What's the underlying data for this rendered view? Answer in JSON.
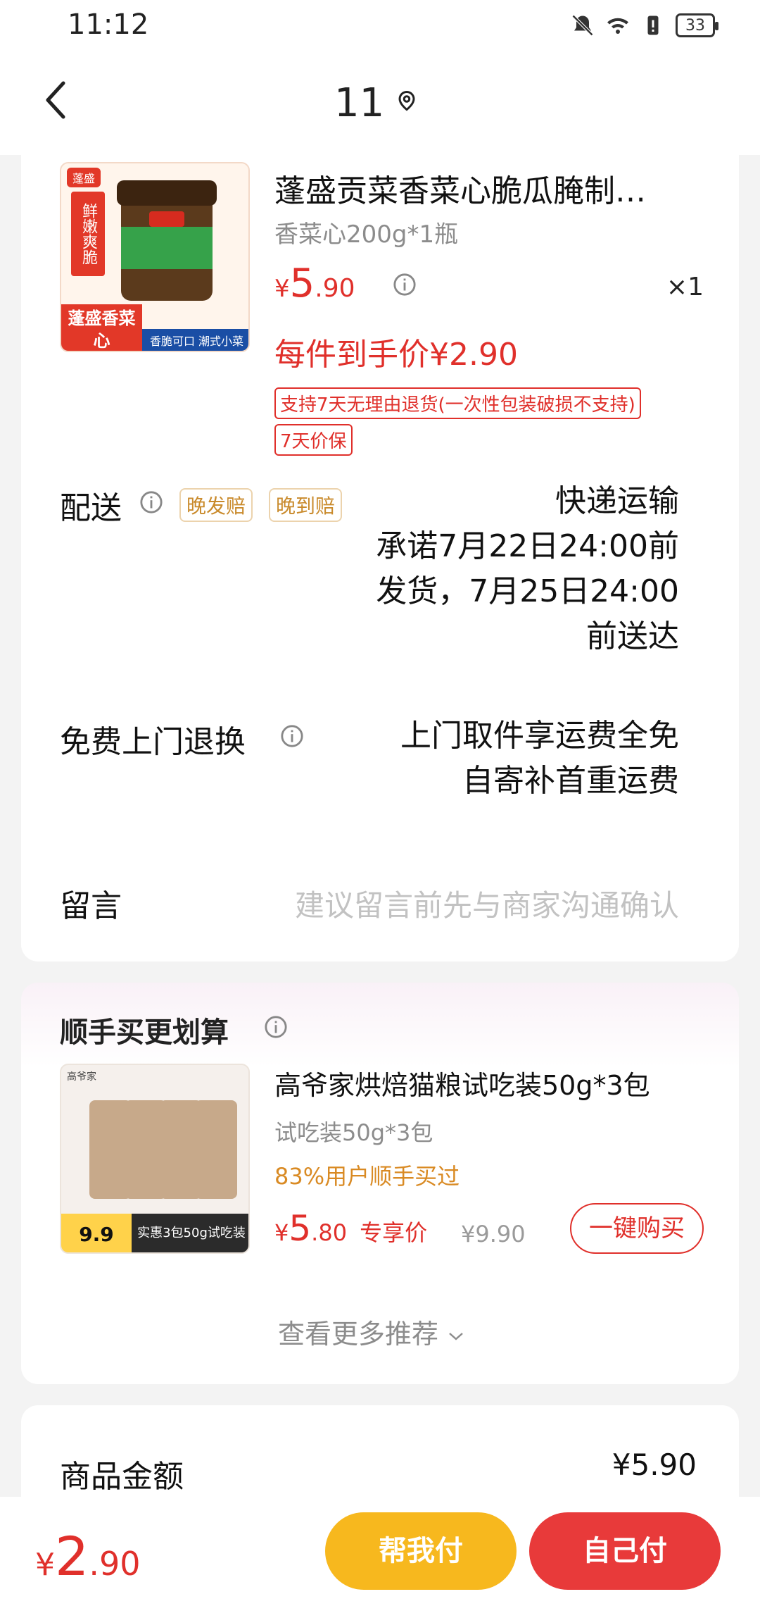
{
  "status_bar": {
    "time": "11:12",
    "battery": "33",
    "icons": [
      "bell-off-icon",
      "wifi-icon",
      "battery-alert-icon",
      "battery-icon"
    ]
  },
  "header": {
    "title": "11",
    "back_icon": "chevron-left-icon",
    "location_icon": "location-pin-icon"
  },
  "product": {
    "title": "蓬盛贡菜香菜心脆瓜腌制…",
    "spec": "香菜心200g*1瓶",
    "price": {
      "currency": "¥",
      "integer": "5",
      "decimal": ".90"
    },
    "qty": "×1",
    "final_price": "每件到手价¥2.90",
    "tags": [
      "支持7天无理由退货(一次性包装破损不支持)",
      "7天价保"
    ],
    "image_text": {
      "badge": "蓬盛",
      "side": "鲜嫩爽脆",
      "brand": "蓬盛香菜心",
      "slogan": "香脆可口 潮式小菜"
    }
  },
  "delivery": {
    "label": "配送",
    "tags": [
      "晚发赔",
      "晚到赔"
    ],
    "lines": [
      "快递运输",
      "承诺7月22日24:00前",
      "发货，7月25日24:00",
      "前送达"
    ]
  },
  "return": {
    "label": "免费上门退换",
    "lines": [
      "上门取件享运费全免",
      "自寄补首重运费"
    ]
  },
  "message": {
    "label": "留言",
    "placeholder": "建议留言前先与商家沟通确认"
  },
  "recommend": {
    "title": "顺手买更划算",
    "item": {
      "name": "高爷家烘焙猫粮试吃装50g*3包",
      "spec": "试吃装50g*3包",
      "stat": "83%用户顺手买过",
      "price": {
        "currency": "¥",
        "integer": "5",
        "decimal": ".80"
      },
      "exclusive": "专享价",
      "original": "¥9.90",
      "buy_button": "一键购买",
      "image_text": {
        "brand": "高爷家",
        "price_tag": "9.9",
        "promo": "实惠3包50g试吃装"
      }
    },
    "more": "查看更多推荐"
  },
  "summary": {
    "label": "商品金额",
    "value": "¥5.90"
  },
  "bottom": {
    "price": {
      "currency": "¥",
      "integer": "2",
      "decimal": ".90"
    },
    "help_pay": "帮我付",
    "self_pay": "自己付"
  },
  "colors": {
    "accent_red": "#e0302b",
    "help_button": "#f7b81e",
    "pay_button": "#e83a3a",
    "stat_orange": "#d98a23"
  }
}
